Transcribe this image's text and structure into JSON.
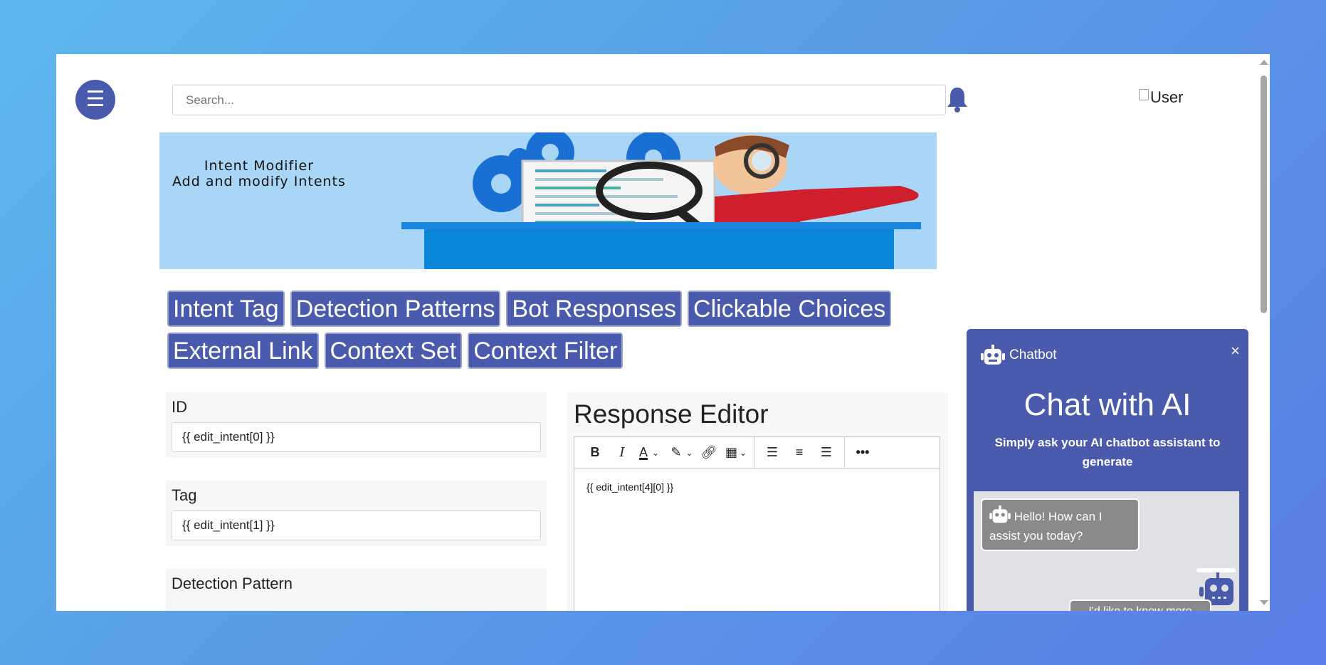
{
  "header": {
    "menu_icon": "☰",
    "search_placeholder": "Search...",
    "user_alt": "User"
  },
  "banner": {
    "line1": "Intent Modifier",
    "line2": "Add and modify Intents"
  },
  "tabs": {
    "row1": [
      "Intent Tag",
      "Detection Patterns",
      "Bot Responses",
      "Clickable Choices"
    ],
    "row2": [
      "External Link",
      "Context Set",
      "Context Filter"
    ]
  },
  "form": {
    "id_label": "ID",
    "id_value": "{{ edit_intent[0] }}",
    "tag_label": "Tag",
    "tag_value": "{{ edit_intent[1] }}",
    "pattern_label": "Detection Pattern"
  },
  "editor": {
    "title": "Response Editor",
    "content": "{{ edit_intent[4][0] }}"
  },
  "chatbot": {
    "header_label": "Chatbot",
    "close": "×",
    "title": "Chat with AI",
    "subtitle": "Simply ask your AI chatbot assistant to generate",
    "bot_message": "Hello! How can I assist you today?",
    "user_message": "I'd like to know more"
  },
  "colors": {
    "accent": "#4a5aad",
    "background_start": "#5cb8ec",
    "background_end": "#5a7de6"
  }
}
